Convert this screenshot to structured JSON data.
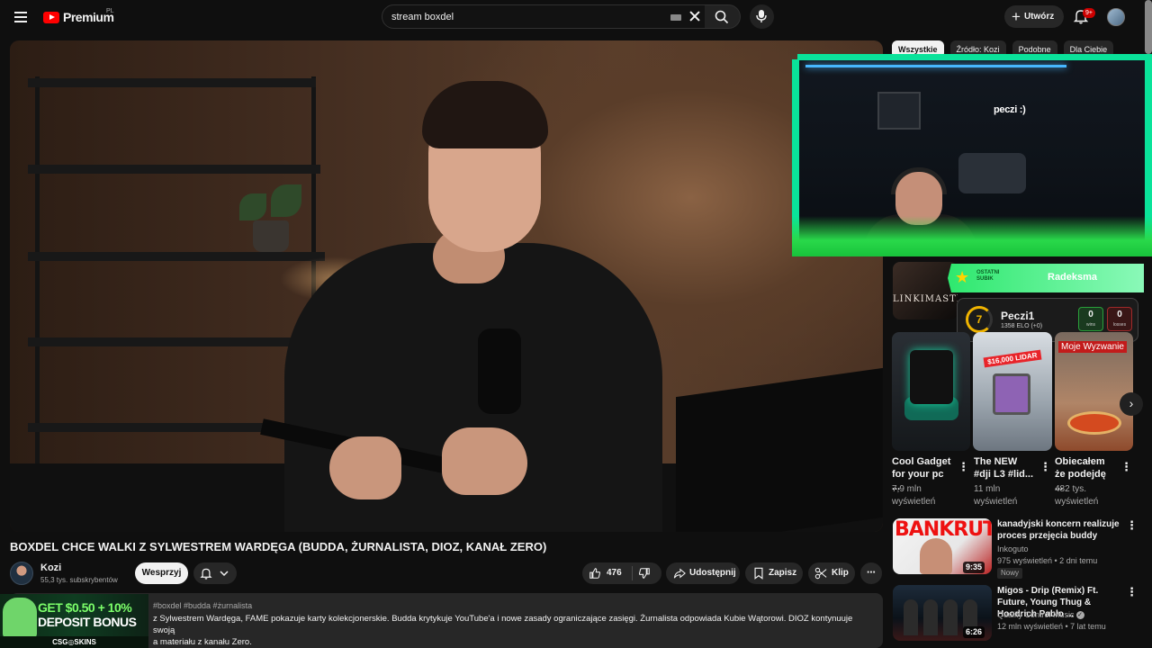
{
  "topbar": {
    "logo_text": "Premium",
    "logo_country": "PL",
    "search_value": "stream boxdel",
    "create_label": "Utwórz",
    "notifications_count": "9+"
  },
  "chips": [
    "Wszystkie",
    "Źródło: Kozi",
    "Podobne",
    "Dla Ciebie"
  ],
  "player": {
    "stream_overlay_text": "peczi :)",
    "sub_alert": {
      "label": "OSTATNI SUBIK",
      "name": "Radeksma"
    },
    "elo": {
      "level": "7",
      "name": "Peczi1",
      "elo_text": "1358 ELO (+0)",
      "wins": "0",
      "wins_label": "wins",
      "losses": "0",
      "losses_label": "losses"
    }
  },
  "video": {
    "title": "BOXDEL CHCE WALKI Z SYLWESTREM WARDĘGA (BUDDA, ŻURNALISTA, DIOZ, KANAŁ ZERO)",
    "channel": "Kozi",
    "subscribers": "55,3 tys. subskrybentów",
    "support_label": "Wesprzyj",
    "likes": "476",
    "share_label": "Udostępnij",
    "save_label": "Zapisz",
    "clip_label": "Klip",
    "more_label": "⋯",
    "description_tags": "#boxdel #budda #żurnalista",
    "description": "z Sylwestrem Wardęga, FAME pokazuje karty kolekcjonerskie. Budda krytykuje YouTube'a i nowe zasady ograniczające zasięgi. Żurnalista odpowiada Kubie Wątorowi. DIOZ kontynuuje swoją\na materiału z kanału Zero."
  },
  "ad": {
    "line1": "GET $0.50 + 10%",
    "line2": "DEPOSIT BONUS",
    "brand": "CSG◎SKINS"
  },
  "shorts": {
    "top_title": "LINKIMASTER",
    "items": [
      {
        "title": "Cool Gadget for your pc ...",
        "views": "7,9 mln wyświetleń"
      },
      {
        "title": "The NEW #dji L3 #lid...",
        "views": "11 mln wyświetleń",
        "badge": "$16,000 LIDAR"
      },
      {
        "title": "Obiecałem że podejdę ...",
        "views": "482 tys. wyświetleń",
        "badge": "Moje Wyzwanie"
      }
    ]
  },
  "related": [
    {
      "title": "kanadyjski koncern realizuje proces przejęcia buddy",
      "channel": "Inkoguto",
      "meta": "975 wyświetleń • 2 dni temu",
      "badge": "Nowy",
      "duration": "9:35",
      "thumb_text": "BANKRUT"
    },
    {
      "title": "Migos - Drip (Remix) Ft. Future, Young Thug & Hoodrich Pablo ...",
      "channel": "Quality Control Music",
      "meta": "12 mln wyświetleń • 7 lat temu",
      "duration": "6:26"
    }
  ],
  "colors": {
    "accent": "#ff0000",
    "background": "#0f0f0f",
    "overlay_green": "#0ae39a"
  }
}
